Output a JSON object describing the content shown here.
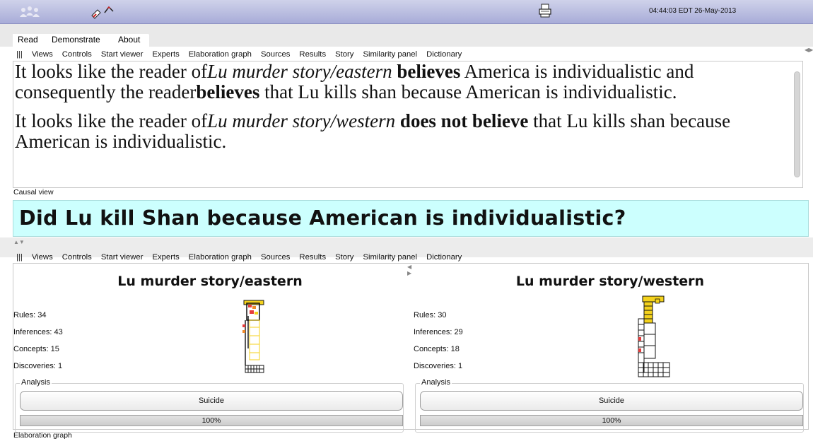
{
  "topbar": {
    "clock": "04:44:03 EDT 26-May-2013",
    "logo_icon": "people-logo-icon",
    "tool_icon": "tool-arrows-icon",
    "print_icon": "printer-icon",
    "bar_color": "#b4b8de"
  },
  "menu": {
    "items": [
      "Read",
      "Demonstrate",
      "About"
    ]
  },
  "toolbar": {
    "items": [
      "|||",
      "Views",
      "Controls",
      "Start viewer",
      "Experts",
      "Elaboration graph",
      "Sources",
      "Results",
      "Story",
      "Similarity panel",
      "Dictionary"
    ]
  },
  "reader": {
    "p1_a": "It looks like the reader of",
    "p1_story": "Lu murder story/eastern",
    "p1_b": " ",
    "p1_verb": "believes",
    "p1_c": " America is individualistic and consequently the reader",
    "p1_verb2": "believes",
    "p1_d": " that Lu kills shan because American is individualistic.",
    "p2_a": "It looks like the reader of",
    "p2_story": "Lu murder story/western",
    "p2_b": " ",
    "p2_verb": "does not believe",
    "p2_c": "  that Lu kills shan because American is individualistic."
  },
  "status": {
    "causal": "Causal view",
    "elaboration": "Elaboration graph"
  },
  "question": {
    "text": "Did Lu kill Shan because American is individualistic?",
    "bg_color": "#ccfffe"
  },
  "stories": [
    {
      "title": "Lu murder story/eastern",
      "rules": "Rules: 34",
      "inferences": "Inferences: 43",
      "concepts": "Concepts: 15",
      "discoveries": "Discoveries: 1",
      "analysis_label": "Analysis",
      "button": "Suicide",
      "progress_text": "100%",
      "progress": 1.0
    },
    {
      "title": "Lu murder story/western",
      "rules": "Rules: 30",
      "inferences": "Inferences: 29",
      "concepts": "Concepts: 18",
      "discoveries": "Discoveries: 1",
      "analysis_label": "Analysis",
      "button": "Suicide",
      "progress_text": "100%",
      "progress": 1.0
    }
  ]
}
